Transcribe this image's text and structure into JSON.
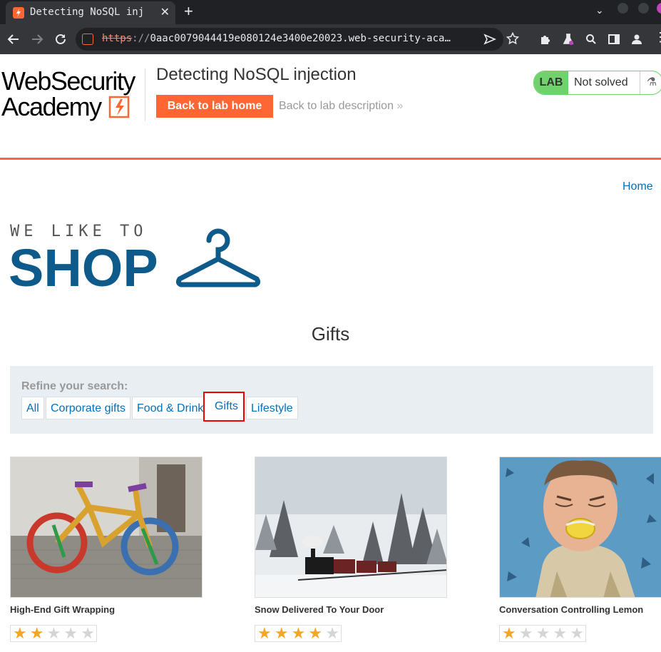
{
  "browser": {
    "tab_title": "Detecting NoSQL inj",
    "close_glyph": "✕",
    "newtab_glyph": "+",
    "url_proto": "https",
    "url_sep": "://",
    "url_rest": "0aac0079044419e080124e3400e20023.web-security-aca…"
  },
  "header": {
    "logo_line1": "WebSecurity",
    "logo_line2": "Academy",
    "lab_title": "Detecting NoSQL injection",
    "back_home": "Back to lab home",
    "back_desc": "Back to lab description",
    "back_desc_icon": "»",
    "status_badge": "LAB",
    "status_text": "Not solved",
    "flask_icon": "⚗"
  },
  "nav": {
    "home": "Home"
  },
  "shop_logo": {
    "top": "WE LIKE TO",
    "main": "SHOP"
  },
  "page": {
    "title": "Gifts"
  },
  "filter": {
    "label": "Refine your search:",
    "options": [
      "All",
      "Corporate gifts",
      "Food & Drink",
      "Gifts",
      "Lifestyle"
    ],
    "selected": "Gifts"
  },
  "products": [
    {
      "name": "High-End Gift Wrapping",
      "rating": 2
    },
    {
      "name": "Snow Delivered To Your Door",
      "rating": 4
    },
    {
      "name": "Conversation Controlling Lemon",
      "rating": 1
    }
  ],
  "colors": {
    "accent": "#ff6633",
    "link": "#0071bc",
    "lab_green": "#70d16d",
    "shop_blue": "#0e5a8a",
    "star": "#f5a623"
  }
}
